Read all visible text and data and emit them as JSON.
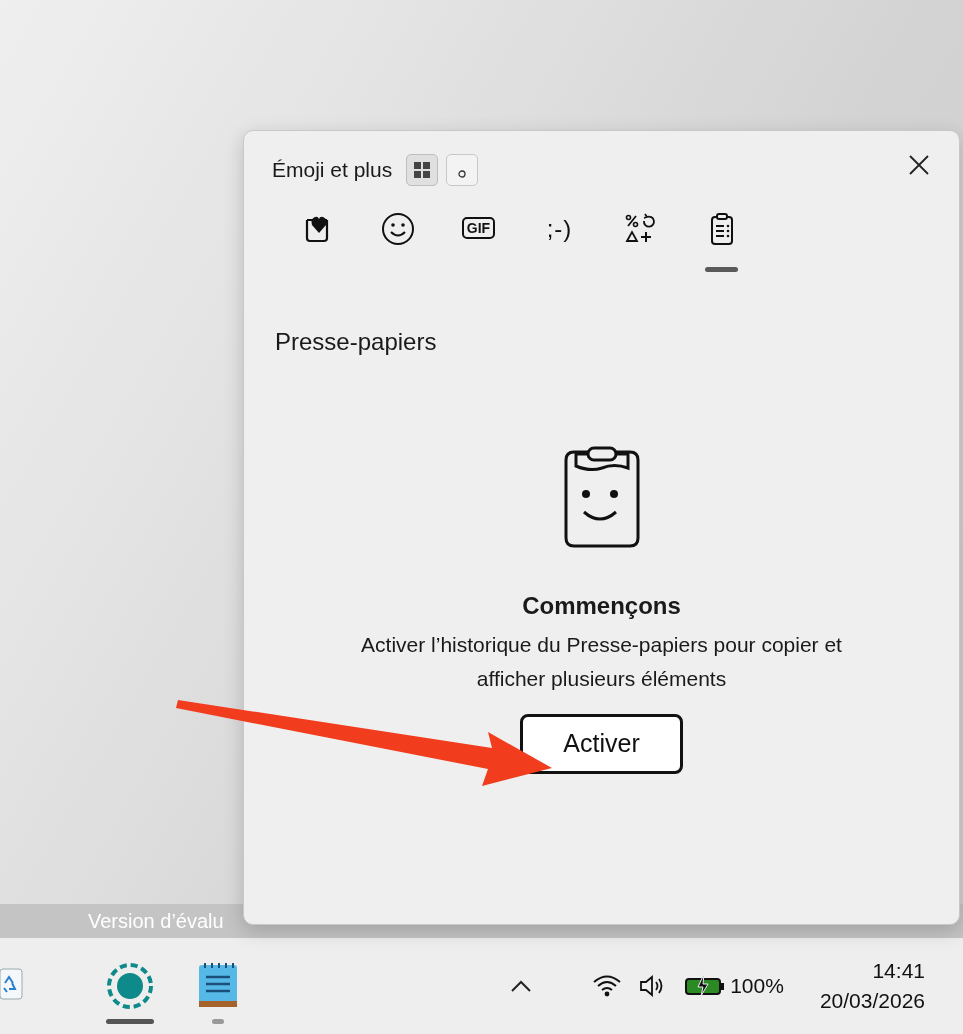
{
  "desktop": {
    "watermark_text": "Version d’évalu"
  },
  "panel": {
    "title": "Émoji et plus",
    "mode_buttons": [
      {
        "kind": "grid",
        "selected": true
      },
      {
        "kind": "dot",
        "selected": false
      }
    ],
    "tabs": [
      {
        "kind": "favorites",
        "selected": false
      },
      {
        "kind": "emoji",
        "selected": false
      },
      {
        "kind": "gif",
        "label": "GIF",
        "selected": false
      },
      {
        "kind": "kaomoji",
        "label": ";-)",
        "selected": false
      },
      {
        "kind": "symbols",
        "selected": false
      },
      {
        "kind": "clipboard",
        "selected": true
      }
    ],
    "section_title": "Presse-papiers",
    "heading": "Commençons",
    "description": "Activer l’historique du Presse-papiers pour copier et afficher plusieurs éléments",
    "button": "Activer"
  },
  "taskbar": {
    "apps": [
      {
        "kind": "recycle-bin",
        "running": false,
        "focused": false
      },
      {
        "kind": "app",
        "running": true,
        "focused": true
      },
      {
        "kind": "notepad",
        "running": true,
        "focused": false
      }
    ],
    "battery": "100%",
    "time": "14:41",
    "date": "20/03/2026"
  }
}
